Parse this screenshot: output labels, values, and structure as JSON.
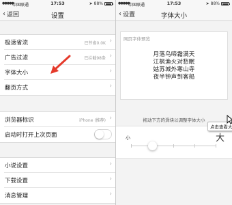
{
  "left_screen": {
    "status": {
      "carrier": "中国联通",
      "time": "17:53",
      "battery": "88%"
    },
    "nav": {
      "back_label": "返回",
      "title": "设置"
    },
    "group1": [
      {
        "label": "极速省流",
        "value": "已节省0.0K"
      },
      {
        "label": "广告过滤",
        "value": "已拦截98条"
      },
      {
        "label": "字体大小",
        "value": ""
      },
      {
        "label": "翻页方式",
        "value": ""
      }
    ],
    "group2": [
      {
        "label": "浏览器标识",
        "value": "iPhone (推荐)"
      },
      {
        "label": "启动时打开上次页面",
        "value": ""
      }
    ],
    "group3": [
      {
        "label": "小说设置",
        "value": ""
      },
      {
        "label": "下载设置",
        "value": ""
      },
      {
        "label": "消息管理",
        "value": ""
      }
    ],
    "colors": {
      "annotation_arrow": "#e53a2b",
      "toggle_on": false
    }
  },
  "right_screen": {
    "status": {
      "carrier": "中国联通",
      "time": "17:53",
      "battery": "88%"
    },
    "nav": {
      "back_label": "设置",
      "title": "字体大小"
    },
    "preview_label": "网页字体预览",
    "poem": [
      "月落乌啼霜满天",
      "江枫渔火对愁眠",
      "姑苏城外寒山寺",
      "夜半钟声到客船"
    ],
    "hint": "拖动下方的滑块以调整字体大小",
    "tooltip": "点击查看大图",
    "slider": {
      "small_label": "小",
      "large_label": "大",
      "steps": 5,
      "current_step": 1
    }
  }
}
